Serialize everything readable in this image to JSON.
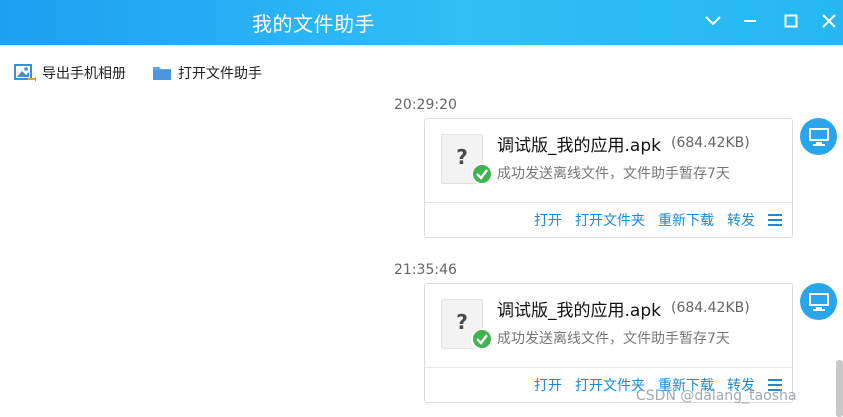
{
  "window": {
    "title": "我的文件助手",
    "accent_color": "#2aa5ec"
  },
  "toolbar": {
    "export_label": "导出手机相册",
    "export_icon": "photo-export-icon",
    "open_folder_label": "打开文件助手",
    "open_folder_icon": "folder-icon"
  },
  "messages": [
    {
      "timestamp": "20:29:20",
      "file_name": "调试版_我的应用.apk",
      "file_size": "(684.42KB)",
      "status": "成功发送离线文件，文件助手暂存7天",
      "actions": [
        "打开",
        "打开文件夹",
        "重新下载",
        "转发"
      ]
    },
    {
      "timestamp": "21:35:46",
      "file_name": "调试版_我的应用.apk",
      "file_size": "(684.42KB)",
      "status": "成功发送离线文件，文件助手暂存7天",
      "actions": [
        "打开",
        "打开文件夹",
        "重新下载",
        "转发"
      ]
    }
  ],
  "watermark": "CSDN @dalang_taosha"
}
